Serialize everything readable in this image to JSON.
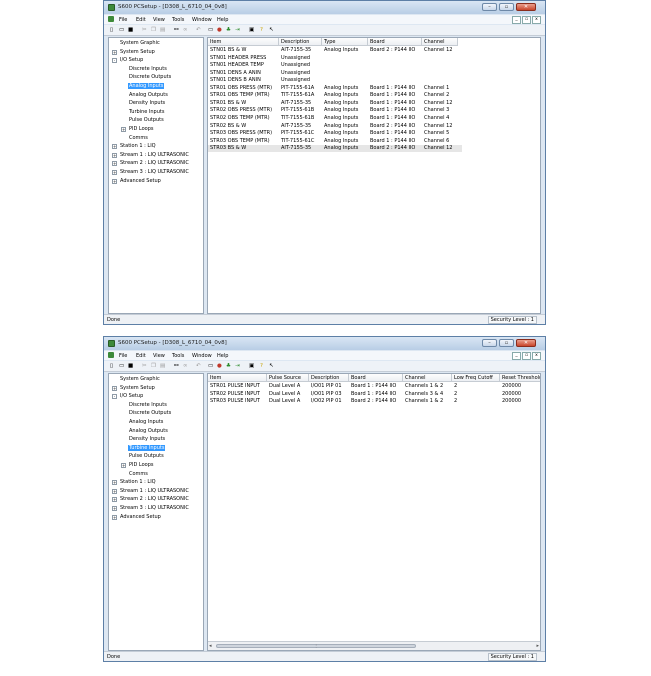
{
  "window1": {
    "title": "S600 PCSetup - [D308_L_6710_04_0v8]",
    "menu": [
      "File",
      "Edit",
      "View",
      "Tools",
      "Window",
      "Help"
    ],
    "tree": [
      {
        "label": "System Graphic"
      },
      {
        "label": "System Setup",
        "expander": "+"
      },
      {
        "label": "I/O Setup",
        "expander": "-"
      },
      {
        "label": "Discrete Inputs"
      },
      {
        "label": "Discrete Outputs"
      },
      {
        "label": "Analog Inputs",
        "selected": true
      },
      {
        "label": "Analog Outputs"
      },
      {
        "label": "Density Inputs"
      },
      {
        "label": "Turbine Inputs"
      },
      {
        "label": "Pulse Outputs"
      },
      {
        "label": "PID Loops",
        "expander": "+"
      },
      {
        "label": "Comms"
      },
      {
        "label": "Station 1 : LIQ",
        "expander": "+"
      },
      {
        "label": "Stream 1 : LIQ ULTRASONIC",
        "expander": "+"
      },
      {
        "label": "Stream 2 : LIQ ULTRASONIC",
        "expander": "+"
      },
      {
        "label": "Stream 3 : LIQ ULTRASONIC",
        "expander": "+"
      },
      {
        "label": "Advanced Setup",
        "expander": "+"
      }
    ],
    "columns": [
      "Item",
      "Description",
      "Type",
      "Board",
      "Channel"
    ],
    "rows": [
      [
        "STN01 BS & W",
        "AIT-7155-35",
        "Analog Inputs",
        "Board 2 : P144 IIO",
        "Channel 12"
      ],
      [
        "STN01 HEADER PRESS",
        "Unassigned",
        "",
        "",
        ""
      ],
      [
        "STN01 HEADER TEMP",
        "Unassigned",
        "",
        "",
        ""
      ],
      [
        "STN01 DENS A ANIN",
        "Unassigned",
        "",
        "",
        ""
      ],
      [
        "STN01 DENS B ANIN",
        "Unassigned",
        "",
        "",
        ""
      ],
      [
        "STR01 OBS PRESS (MTR)",
        "PIT-7155-61A",
        "Analog Inputs",
        "Board 1 : P144 IIO",
        "Channel 1"
      ],
      [
        "STR01 OBS TEMP (MTR)",
        "TIT-7155-61A",
        "Analog Inputs",
        "Board 1 : P144 IIO",
        "Channel 2"
      ],
      [
        "STR01 BS & W",
        "AIT-7155-35",
        "Analog Inputs",
        "Board 1 : P144 IIO",
        "Channel 12"
      ],
      [
        "STR02 OBS PRESS (MTR)",
        "PIT-7155-61B",
        "Analog Inputs",
        "Board 1 : P144 IIO",
        "Channel 3"
      ],
      [
        "STR02 OBS TEMP (MTR)",
        "TIT-7155-61B",
        "Analog Inputs",
        "Board 1 : P144 IIO",
        "Channel 4"
      ],
      [
        "STR02 BS & W",
        "AIT-7155-35",
        "Analog Inputs",
        "Board 2 : P144 IIO",
        "Channel 12"
      ],
      [
        "STR03 OBS PRESS (MTR)",
        "PIT-7155-61C",
        "Analog Inputs",
        "Board 1 : P144 IIO",
        "Channel 5"
      ],
      [
        "STR03 OBS TEMP (MTR)",
        "TIT-7155-61C",
        "Analog Inputs",
        "Board 1 : P144 IIO",
        "Channel 6"
      ],
      [
        "STR03 BS & W",
        "AIT-7155-35",
        "Analog Inputs",
        "Board 2 : P144 IIO",
        "Channel 12"
      ]
    ],
    "highlighted_row": 13,
    "status_left": "Done",
    "status_right": "Security Level : 1"
  },
  "window2": {
    "title": "S600 PCSetup - [D308_L_6710_04_0v8]",
    "menu": [
      "File",
      "Edit",
      "View",
      "Tools",
      "Window",
      "Help"
    ],
    "tree": [
      {
        "label": "System Graphic"
      },
      {
        "label": "System Setup",
        "expander": "+"
      },
      {
        "label": "I/O Setup",
        "expander": "-"
      },
      {
        "label": "Discrete Inputs"
      },
      {
        "label": "Discrete Outputs"
      },
      {
        "label": "Analog Inputs"
      },
      {
        "label": "Analog Outputs"
      },
      {
        "label": "Density Inputs"
      },
      {
        "label": "Turbine Inputs",
        "selected": true
      },
      {
        "label": "Pulse Outputs"
      },
      {
        "label": "PID Loops",
        "expander": "+"
      },
      {
        "label": "Comms"
      },
      {
        "label": "Station 1 : LIQ",
        "expander": "+"
      },
      {
        "label": "Stream 1 : LIQ ULTRASONIC",
        "expander": "+"
      },
      {
        "label": "Stream 2 : LIQ ULTRASONIC",
        "expander": "+"
      },
      {
        "label": "Stream 3 : LIQ ULTRASONIC",
        "expander": "+"
      },
      {
        "label": "Advanced Setup",
        "expander": "+"
      }
    ],
    "columns": [
      "Item",
      "Pulse Source",
      "Description",
      "Board",
      "Channel",
      "Low Freq Cutoff",
      "Reset Threshold"
    ],
    "rows": [
      [
        "STR01 PULSE INPUT",
        "Dual Level A",
        "I/O01 PIP 01",
        "Board 1 : P144 IIO",
        "Channels 1 & 2",
        "2",
        "200000"
      ],
      [
        "STR02 PULSE INPUT",
        "Dual Level A",
        "I/O01 PIP 03",
        "Board 1 : P144 IIO",
        "Channels 3 & 4",
        "2",
        "200000"
      ],
      [
        "STR03 PULSE INPUT",
        "Dual Level A",
        "I/O02 PIP 01",
        "Board 2 : P144 IIO",
        "Channels 1 & 2",
        "2",
        "200000"
      ]
    ],
    "status_left": "Done",
    "status_right": "Security Level : 1"
  }
}
